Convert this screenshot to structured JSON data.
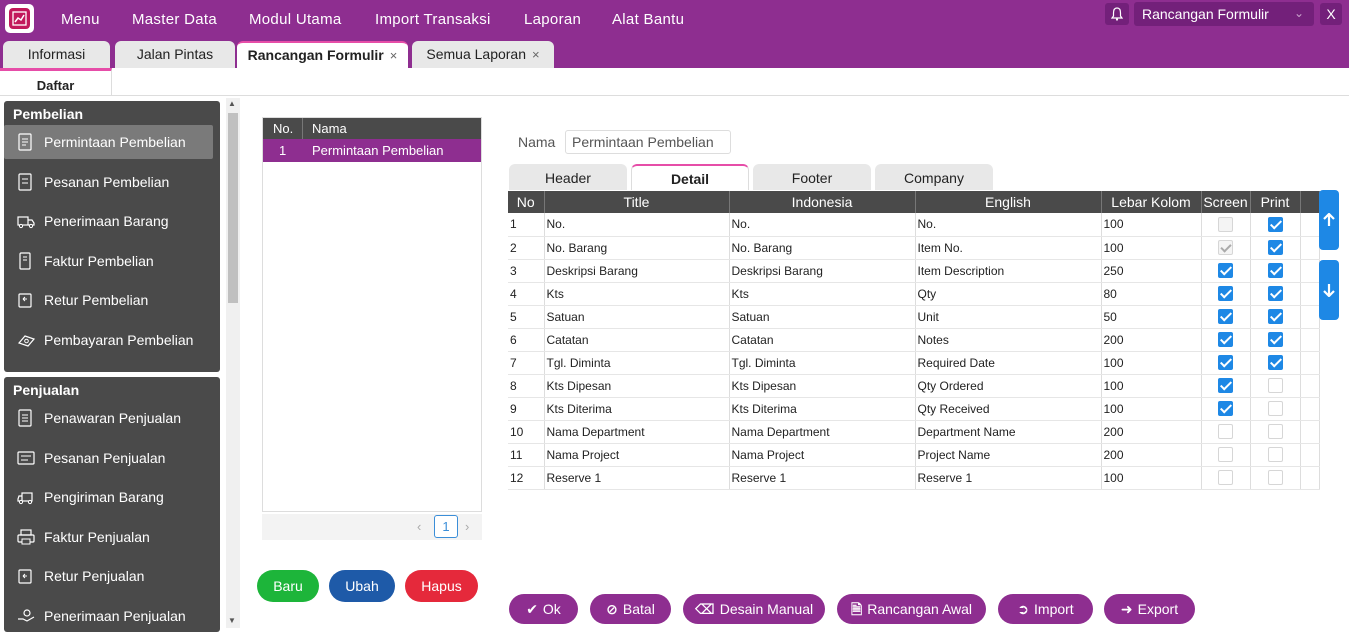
{
  "menu": [
    "Menu",
    "Master Data",
    "Modul Utama",
    "Import Transaksi",
    "Laporan",
    "Alat Bantu"
  ],
  "form_selector": {
    "value": "Rancangan Formulir",
    "close": "X"
  },
  "tabs": [
    {
      "label": "Informasi"
    },
    {
      "label": "Jalan Pintas"
    },
    {
      "label": "Rancangan Formulir",
      "close": "×"
    },
    {
      "label": "Semua Laporan",
      "close": "×"
    }
  ],
  "subtab": "Daftar",
  "sidebar": {
    "pembelian": {
      "title": "Pembelian",
      "items": [
        "Permintaan Pembelian",
        "Pesanan Pembelian",
        "Penerimaan Barang",
        "Faktur Pembelian",
        "Retur Pembelian",
        "Pembayaran Pembelian"
      ]
    },
    "penjualan": {
      "title": "Penjualan",
      "items": [
        "Penawaran Penjualan",
        "Pesanan Penjualan",
        "Pengiriman Barang",
        "Faktur Penjualan",
        "Retur Penjualan",
        "Penerimaan Penjualan"
      ]
    }
  },
  "list": {
    "headers": [
      "No.",
      "Nama"
    ],
    "rows": [
      {
        "no": "1",
        "nama": "Permintaan Pembelian"
      }
    ],
    "page": "1",
    "prev": "‹",
    "next": "›"
  },
  "actions": {
    "baru": "Baru",
    "ubah": "Ubah",
    "hapus": "Hapus"
  },
  "detail": {
    "nama_label": "Nama",
    "nama_value": "Permintaan Pembelian",
    "tabs": [
      "Header",
      "Detail",
      "Footer",
      "Company"
    ],
    "headers": [
      "No",
      "Title",
      "Indonesia",
      "English",
      "Lebar Kolom",
      "Screen",
      "Print"
    ],
    "rows": [
      {
        "no": "1",
        "title": "No.",
        "indonesia": "No.",
        "english": "No.",
        "width": "100",
        "screen": "disabled",
        "print": "checked"
      },
      {
        "no": "2",
        "title": "No. Barang",
        "indonesia": "No. Barang",
        "english": "Item No.",
        "width": "100",
        "screen": "disabled-checked",
        "print": "checked"
      },
      {
        "no": "3",
        "title": "Deskripsi Barang",
        "indonesia": "Deskripsi Barang",
        "english": "Item Description",
        "width": "250",
        "screen": "checked",
        "print": "checked"
      },
      {
        "no": "4",
        "title": "Kts",
        "indonesia": "Kts",
        "english": "Qty",
        "width": "80",
        "screen": "checked",
        "print": "checked"
      },
      {
        "no": "5",
        "title": "Satuan",
        "indonesia": "Satuan",
        "english": "Unit",
        "width": "50",
        "screen": "checked",
        "print": "checked"
      },
      {
        "no": "6",
        "title": "Catatan",
        "indonesia": "Catatan",
        "english": "Notes",
        "width": "200",
        "screen": "checked",
        "print": "checked"
      },
      {
        "no": "7",
        "title": "Tgl. Diminta",
        "indonesia": "Tgl. Diminta",
        "english": "Required Date",
        "width": "100",
        "screen": "checked",
        "print": "checked"
      },
      {
        "no": "8",
        "title": "Kts Dipesan",
        "indonesia": "Kts Dipesan",
        "english": "Qty Ordered",
        "width": "100",
        "screen": "checked",
        "print": "unchecked"
      },
      {
        "no": "9",
        "title": "Kts Diterima",
        "indonesia": "Kts Diterima",
        "english": "Qty Received",
        "width": "100",
        "screen": "checked",
        "print": "unchecked"
      },
      {
        "no": "10",
        "title": "Nama Department",
        "indonesia": "Nama Department",
        "english": "Department Name",
        "width": "200",
        "screen": "unchecked",
        "print": "unchecked"
      },
      {
        "no": "11",
        "title": "Nama Project",
        "indonesia": "Nama Project",
        "english": "Project Name",
        "width": "200",
        "screen": "unchecked",
        "print": "unchecked"
      },
      {
        "no": "12",
        "title": "Reserve 1",
        "indonesia": "Reserve 1",
        "english": "Reserve 1",
        "width": "100",
        "screen": "unchecked",
        "print": "unchecked"
      }
    ]
  },
  "bottom_buttons": [
    {
      "label": "Ok",
      "icon": "check-icon"
    },
    {
      "label": "Batal",
      "icon": "ban-icon"
    },
    {
      "label": "Desain Manual",
      "icon": "eraser-icon"
    },
    {
      "label": "Rancangan Awal",
      "icon": "file-icon"
    },
    {
      "label": "Import",
      "icon": "arrow-left-circle-icon"
    },
    {
      "label": "Export",
      "icon": "arrow-right-circle-icon"
    }
  ],
  "colors": {
    "brand": "#8e2e90",
    "accent": "#e64da8",
    "blue": "#1e88e5",
    "green": "#1db53a",
    "navy": "#1e5aa8",
    "red": "#e5293b",
    "panel": "#4a4a4a"
  }
}
